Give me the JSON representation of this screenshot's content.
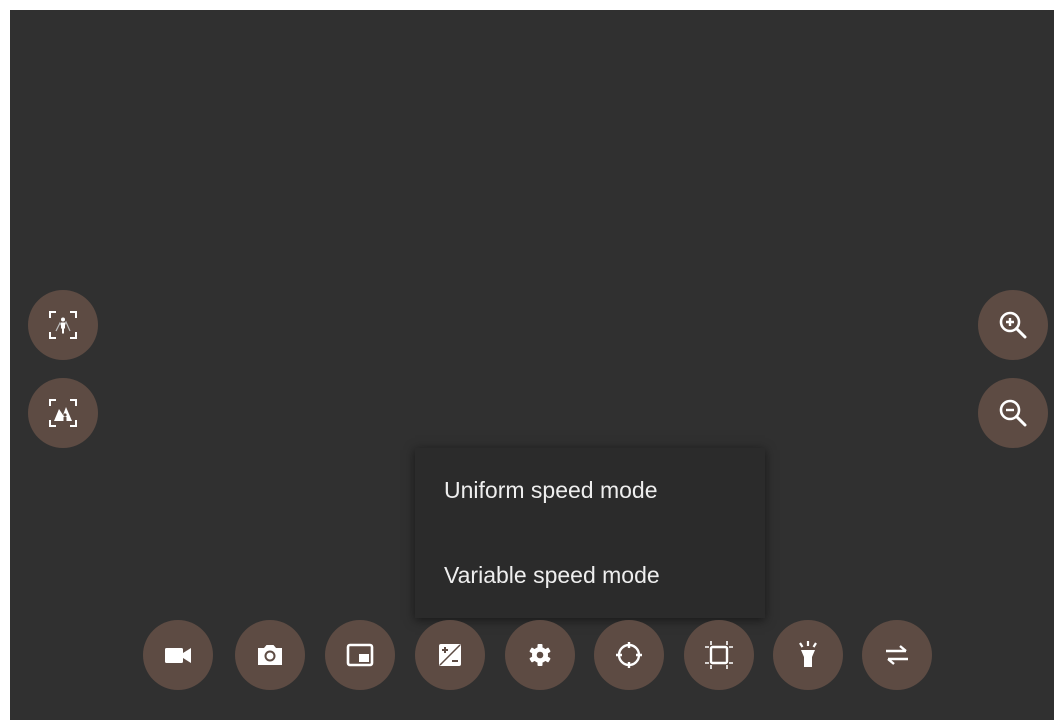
{
  "colors": {
    "background": "#303030",
    "button_fill": "#5d4b43",
    "icon": "#ffffff",
    "menu_background": "#2b2b2b",
    "menu_text": "#eeeeee"
  },
  "left_controls": [
    {
      "icon": "person-focus-icon"
    },
    {
      "icon": "scene-focus-icon"
    }
  ],
  "right_controls": [
    {
      "icon": "zoom-in-icon"
    },
    {
      "icon": "zoom-out-icon"
    }
  ],
  "bottom_toolbar": [
    {
      "icon": "video-camera-icon"
    },
    {
      "icon": "camera-icon"
    },
    {
      "icon": "picture-in-picture-icon"
    },
    {
      "icon": "exposure-icon"
    },
    {
      "icon": "settings-gear-icon"
    },
    {
      "icon": "crosshair-target-icon"
    },
    {
      "icon": "crop-frame-icon"
    },
    {
      "icon": "flashlight-icon"
    },
    {
      "icon": "swap-arrows-icon"
    }
  ],
  "speed_menu": {
    "items": [
      {
        "label": "Uniform speed mode"
      },
      {
        "label": "Variable speed mode"
      }
    ]
  }
}
